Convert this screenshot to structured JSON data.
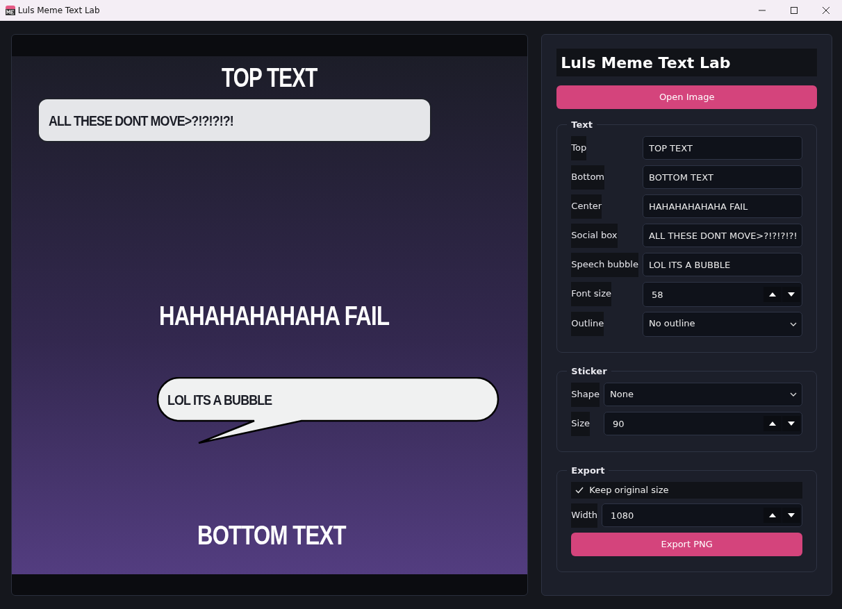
{
  "window": {
    "title": "Luls Meme Text Lab"
  },
  "canvas": {
    "top_text": "TOP TEXT",
    "social_box": "ALL THESE DONT MOVE>?!?!?!?!",
    "center_text": "HAHAHAHAHAHA FAIL",
    "speech_bubble": "LOL ITS A BUBBLE",
    "bottom_text": "BOTTOM TEXT"
  },
  "panel": {
    "title": "Luls Meme Text Lab",
    "open_button": "Open Image",
    "sections": [
      {
        "legend": "Text",
        "rows": [
          {
            "kind": "text",
            "label": "Top",
            "value": "TOP TEXT"
          },
          {
            "kind": "text",
            "label": "Bottom",
            "value": "BOTTOM TEXT"
          },
          {
            "kind": "text",
            "label": "Center",
            "value": "HAHAHAHAHAHA FAIL"
          },
          {
            "kind": "text",
            "label": "Social box",
            "value": "ALL THESE DONT MOVE>?!?!?!?!"
          },
          {
            "kind": "text",
            "label": "Speech bubble",
            "value": "LOL ITS A BUBBLE"
          },
          {
            "kind": "spin",
            "label": "Font size",
            "value": "58"
          },
          {
            "kind": "select",
            "label": "Outline",
            "value": "No outline"
          }
        ]
      },
      {
        "legend": "Sticker",
        "rows": [
          {
            "kind": "select",
            "label": "Shape",
            "value": "None"
          },
          {
            "kind": "spin",
            "label": "Size",
            "value": "90"
          }
        ]
      },
      {
        "legend": "Export",
        "rows": [
          {
            "kind": "check",
            "label": "Keep original size",
            "checked": true
          },
          {
            "kind": "spin",
            "label": "Width",
            "value": "1080"
          },
          {
            "kind": "button",
            "label": "Export PNG"
          }
        ]
      }
    ]
  }
}
